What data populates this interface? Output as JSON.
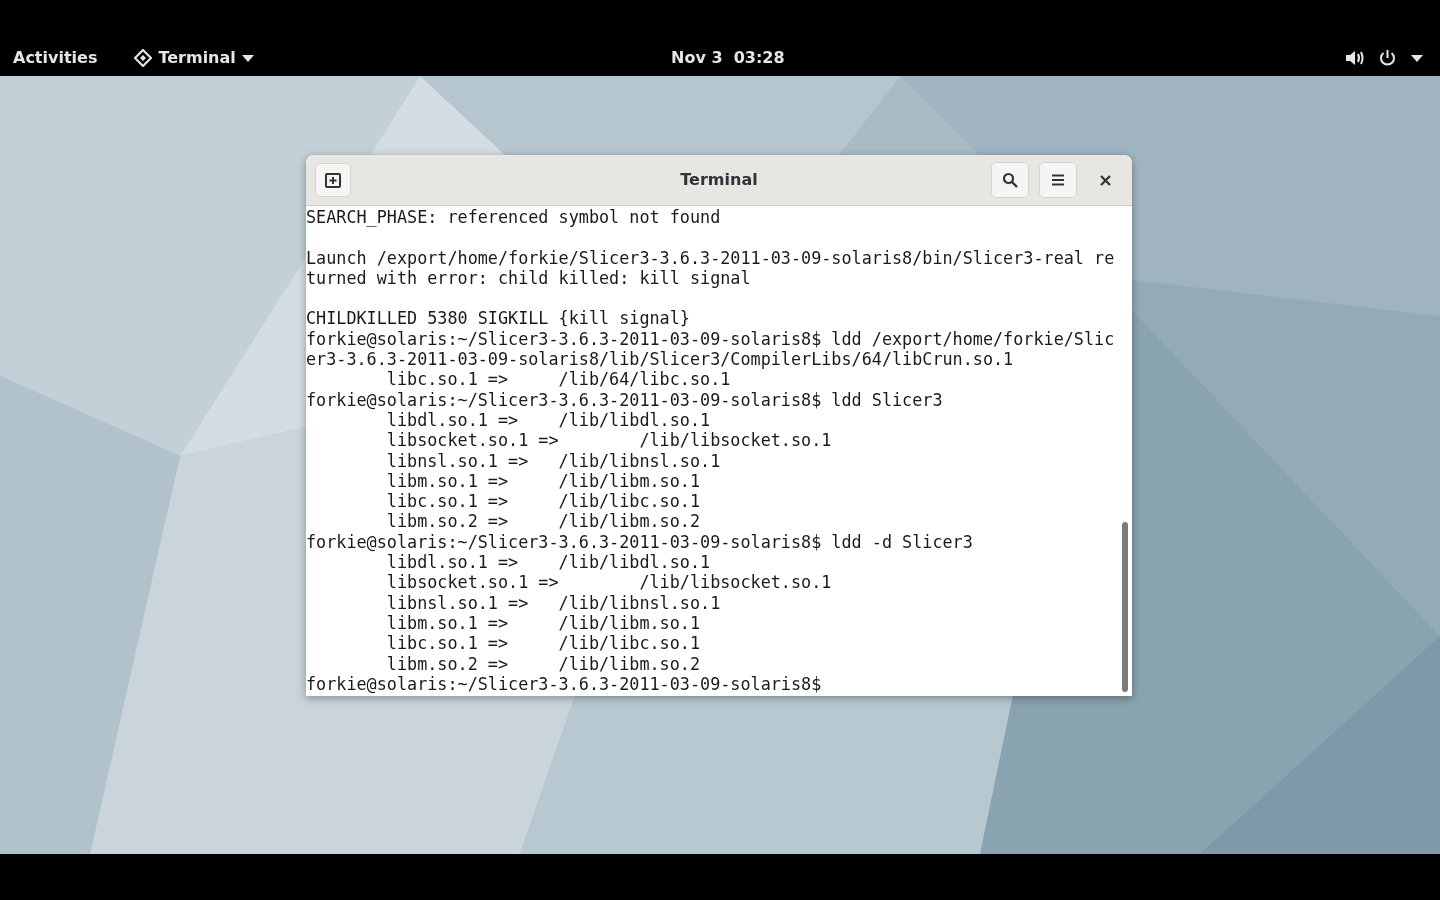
{
  "top_bar": {
    "activities": "Activities",
    "app_menu": "Terminal",
    "clock": "Nov 3  03:28"
  },
  "terminal": {
    "title": "Terminal",
    "blocks": [
      [
        "SEARCH_PHASE: referenced symbol not found"
      ],
      [
        "Launch /export/home/forkie/Slicer3-3.6.3-2011-03-09-solaris8/bin/Slicer3-real re",
        "turned with error: child killed: kill signal"
      ],
      [
        "CHILDKILLED 5380 SIGKILL {kill signal}",
        "forkie@solaris:~/Slicer3-3.6.3-2011-03-09-solaris8$ ldd /export/home/forkie/Slic",
        "er3-3.6.3-2011-03-09-solaris8/lib/Slicer3/CompilerLibs/64/libCrun.so.1",
        "        libc.so.1 =>     /lib/64/libc.so.1",
        "forkie@solaris:~/Slicer3-3.6.3-2011-03-09-solaris8$ ldd Slicer3",
        "        libdl.so.1 =>    /lib/libdl.so.1",
        "        libsocket.so.1 =>        /lib/libsocket.so.1",
        "        libnsl.so.1 =>   /lib/libnsl.so.1",
        "        libm.so.1 =>     /lib/libm.so.1",
        "        libc.so.1 =>     /lib/libc.so.1",
        "        libm.so.2 =>     /lib/libm.so.2",
        "forkie@solaris:~/Slicer3-3.6.3-2011-03-09-solaris8$ ldd -d Slicer3",
        "        libdl.so.1 =>    /lib/libdl.so.1",
        "        libsocket.so.1 =>        /lib/libsocket.so.1",
        "        libnsl.so.1 =>   /lib/libnsl.so.1",
        "        libm.so.1 =>     /lib/libm.so.1",
        "        libc.so.1 =>     /lib/libc.so.1",
        "        libm.so.2 =>     /lib/libm.so.2",
        "forkie@solaris:~/Slicer3-3.6.3-2011-03-09-solaris8$"
      ]
    ]
  }
}
